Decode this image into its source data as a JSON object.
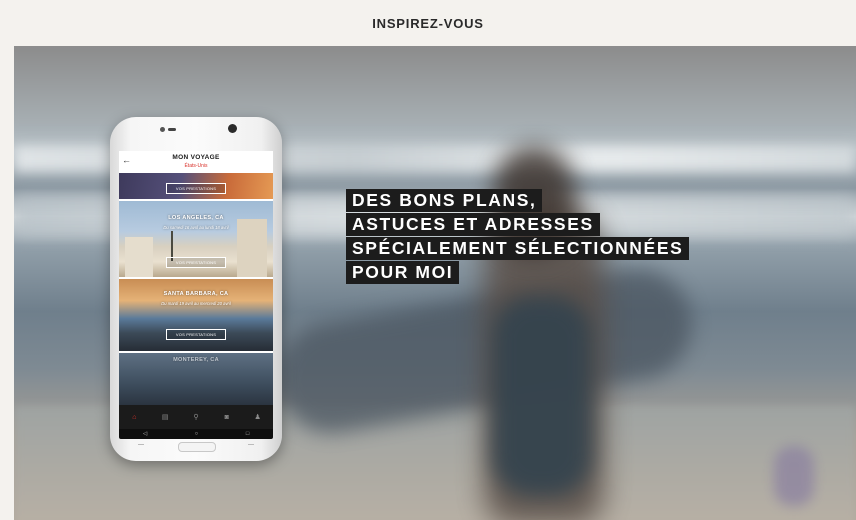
{
  "page": {
    "title": "INSPIREZ-VOUS"
  },
  "headline": {
    "lines": [
      "DES BONS PLANS,",
      "ASTUCES ET ADRESSES",
      "SPÉCIALEMENT SÉLECTIONNÉES",
      "POUR MOI"
    ]
  },
  "phone_app": {
    "back_glyph": "←",
    "title": "MON VOYAGE",
    "subtitle": "États-Unis",
    "cards": [
      {
        "name": "",
        "dates": "",
        "button": "VOS PRESTATIONS"
      },
      {
        "name": "LOS ANGELES, CA",
        "dates": "Du samedi 16 avril au lundi 18 avril",
        "button": "VOS PRESTATIONS"
      },
      {
        "name": "SANTA BARBARA, CA",
        "dates": "Du mardi 19 avril au mercredi 20 avril",
        "button": "VOS PRESTATIONS"
      },
      {
        "name": "MONTEREY, CA",
        "dates": "",
        "button": ""
      }
    ],
    "tabs": [
      {
        "icon": "home-icon",
        "glyph": "⌂",
        "active": true
      },
      {
        "icon": "document-icon",
        "glyph": "▤",
        "active": false
      },
      {
        "icon": "map-pin-icon",
        "glyph": "⚲",
        "active": false
      },
      {
        "icon": "camera-icon",
        "glyph": "◙",
        "active": false
      },
      {
        "icon": "profile-icon",
        "glyph": "♟",
        "active": false
      }
    ],
    "system_nav": [
      {
        "icon": "back-icon",
        "glyph": "◁"
      },
      {
        "icon": "home-circle-icon",
        "glyph": "○"
      },
      {
        "icon": "recent-apps-icon",
        "glyph": "□"
      }
    ]
  },
  "colors": {
    "accent": "#d9322b",
    "headline_bg": "#1c1c1c",
    "top_bar_bg": "#f4f2ee"
  }
}
